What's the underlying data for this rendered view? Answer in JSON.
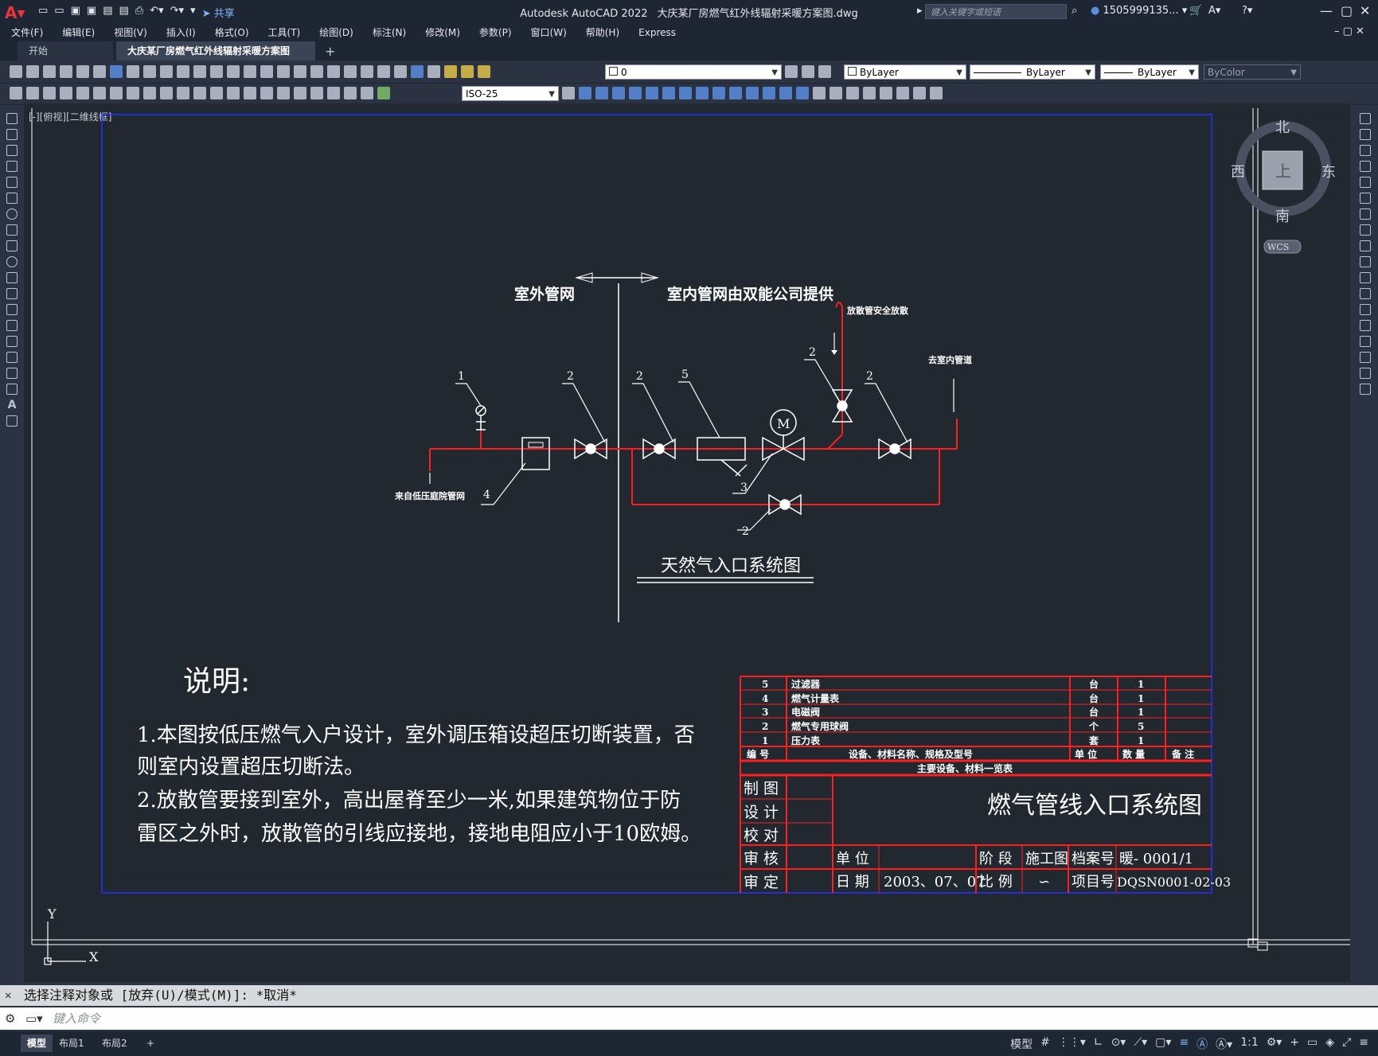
{
  "app": {
    "product": "Autodesk AutoCAD 2022",
    "filename": "大庆某厂房燃气红外线辐射采暖方案图.dwg",
    "share_label": "共享",
    "search_placeholder": "键入关键字或短语",
    "user": "1505999135...",
    "accent": "#e8343c"
  },
  "menu": [
    "文件(F)",
    "编辑(E)",
    "视图(V)",
    "插入(I)",
    "格式(O)",
    "工具(T)",
    "绘图(D)",
    "标注(N)",
    "修改(M)",
    "参数(P)",
    "窗口(W)",
    "帮助(H)",
    "Express"
  ],
  "tabs": {
    "start": "开始",
    "active": "大庆某厂房燃气红外线辐射采暖方案图*",
    "close": "×",
    "plus": "+"
  },
  "toolbar": {
    "layer_value": "0",
    "color": "ByLayer",
    "linetype": "ByLayer",
    "lineweight": "ByLayer",
    "plotstyle": "ByColor",
    "dimstyle": "ISO-25"
  },
  "viewport_label": "[-][俯视][二维线框]",
  "viewcube": {
    "north": "北",
    "south": "南",
    "east": "东",
    "west": "西",
    "top": "上",
    "wcs": "WCS"
  },
  "ucs": {
    "x": "X",
    "y": "Y"
  },
  "drawing": {
    "outdoor": "室外管网",
    "indoor": "室内管网由双能公司提供",
    "vent": "放散管安全放散",
    "to_indoor": "去室内管道",
    "from_source": "来自低压庭院管网",
    "motor": "M",
    "system_title": "天然气入口系统图",
    "callouts": [
      "1",
      "2",
      "2",
      "5",
      "2",
      "2",
      "4",
      "3",
      "2"
    ],
    "notes_title": "说明:",
    "notes": [
      "1.本图按低压燃气入户设计，室外调压箱设超压切断装置，否",
      "则室内设置超压切断法。",
      "2.放散管要接到室外，高出屋脊至少一米,如果建筑物位于防",
      "雷区之外时，放散管的引线应接地，接地电阻应小于10欧姆。"
    ]
  },
  "equipment_table": {
    "rows": [
      [
        "5",
        "过滤器",
        "台",
        "1",
        ""
      ],
      [
        "4",
        "燃气计量表",
        "台",
        "1",
        ""
      ],
      [
        "3",
        "电磁阀",
        "台",
        "1",
        ""
      ],
      [
        "2",
        "燃气专用球阀",
        "个",
        "5",
        ""
      ],
      [
        "1",
        "压力表",
        "套",
        "1",
        ""
      ]
    ],
    "header": [
      "编 号",
      "设备、材料名称、规格及型号",
      "单 位",
      "数 量",
      "备 注"
    ],
    "caption": "主要设备、材料一览表"
  },
  "title_block": {
    "title": "燃气管线入口系统图",
    "roles": [
      "制 图",
      "设 计",
      "校 对",
      "审 核",
      "审 定"
    ],
    "unit_label": "单 位",
    "stage_label": "阶 段",
    "stage_value": "施工图",
    "archive_label": "档案号",
    "archive_value": "暖- 0001/1",
    "date_label": "日 期",
    "date_value": "2003、07、07",
    "scale_label": "比 例",
    "scale_value": "∽",
    "project_label": "项目号",
    "project_value": "DQSN0001-02-03"
  },
  "command": {
    "history": "选择注释对象或 [放弃(U)/模式(M)]: *取消*",
    "prompt": "键入命令"
  },
  "status": {
    "tabs": [
      "模型",
      "布局1",
      "布局2"
    ],
    "model_label": "模型",
    "scale": "1:1"
  }
}
